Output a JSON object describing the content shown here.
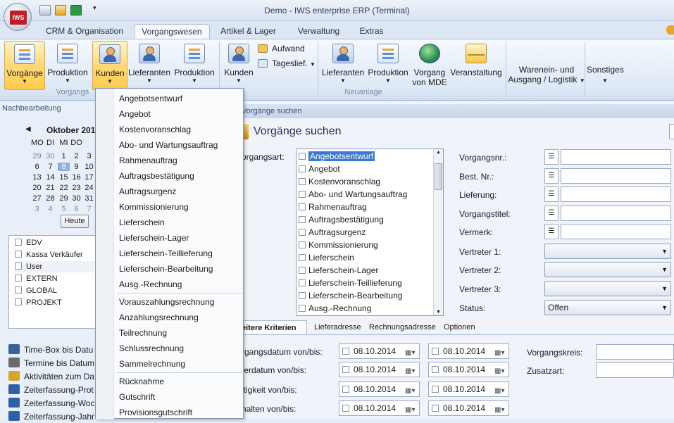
{
  "window": {
    "title": "Demo - IWS enterprise ERP (Terminal)",
    "logo_text": "IWS"
  },
  "tabs": [
    "CRM & Organisation",
    "Vorgangswesen",
    "Artikel & Lager",
    "Verwaltung",
    "Extras"
  ],
  "ribbon": {
    "buttons": {
      "vorgaenge": "Vorgänge",
      "produktion1": "Produktion",
      "kunden1": "Kunden",
      "lieferanten1": "Lieferanten",
      "produktion2": "Produktion",
      "kunden2": "Kunden",
      "aufwand": "Aufwand",
      "tageslief": "Tageslief.",
      "lieferanten2": "Lieferanten",
      "produktion3": "Produktion",
      "vorgang_mde_1": "Vorgang",
      "vorgang_mde_2": "von MDE",
      "veranstaltung": "Veranstaltung",
      "wareneingang_1": "Warenein- und",
      "wareneingang_2": "Ausgang / Logistik",
      "sonstiges": "Sonstiges"
    },
    "groups": {
      "vorgaenge": "Vorgangs",
      "neuanlage": "Neuanlage"
    }
  },
  "left": {
    "header": "Nachbearbeitung",
    "calendar": {
      "month": "Oktober 201",
      "weekdays": [
        "MO",
        "DI",
        "MI",
        "DO"
      ],
      "rows": [
        [
          "29",
          "30",
          "1",
          "2",
          "3"
        ],
        [
          "6",
          "7",
          "8",
          "9",
          "10"
        ],
        [
          "13",
          "14",
          "15",
          "16",
          "17"
        ],
        [
          "20",
          "21",
          "22",
          "23",
          "24"
        ],
        [
          "27",
          "28",
          "29",
          "30",
          "31"
        ],
        [
          "3",
          "4",
          "5",
          "6",
          "7"
        ]
      ],
      "today_label": "Heute"
    },
    "categories": [
      "EDV",
      "Kassa Verkäufer",
      "User",
      "EXTERN",
      "GLOBAL",
      "PROJEKT"
    ],
    "nav": [
      "Time-Box bis Datu",
      "Termine bis Datum",
      "Aktivitäten zum Da",
      "Zeiterfassung-Prot",
      "Zeiterfassung-Woc",
      "Zeiterfassung-Jahr"
    ]
  },
  "main": {
    "breadcrumb": "Vorgänge suchen",
    "title": "Vorgänge suchen",
    "vorgangsart_label": "organgsart:",
    "list": [
      "Angebotsentwurf",
      "Angebot",
      "Kostenvoranschlag",
      "Abo- und Wartungsauftrag",
      "Rahmenauftrag",
      "Auftragsbestätigung",
      "Auftragsurgenz",
      "Kommissionierung",
      "Lieferschein",
      "Lieferschein-Lager",
      "Lieferschein-Teillieferung",
      "Lieferschein-Bearbeitung",
      "Ausg.-Rechnung"
    ],
    "fields": {
      "vorgangsnr": "Vorgangsnr.:",
      "bestnr": "Best. Nr.:",
      "lieferung": "Lieferung:",
      "vorgangstitel": "Vorgangstitel:",
      "vermerk": "Vermerk:",
      "vertreter1": "Vertreter 1:",
      "vertreter2": "Vertreter 2:",
      "vertreter3": "Vertreter 3:",
      "status": "Status:",
      "status_value": "Offen"
    },
    "subtabs": [
      "eitere Kriterien",
      "Lieferadresse",
      "Rechnungsadresse",
      "Optionen"
    ],
    "date_labels": [
      "rgangsdatum von/bis:",
      "ferdatum von/bis:",
      "ltigkeit von/bis:",
      "halten von/bis:"
    ],
    "date_value": "08.10.2014",
    "right_labels": {
      "vorgangskreis": "Vorgangskreis:",
      "zusatzart": "Zusatzart:"
    }
  },
  "menu": {
    "group1": [
      "Angebotsentwurf",
      "Angebot",
      "Kostenvoranschlag",
      "Abo- und Wartungsauftrag",
      "Rahmenauftrag",
      "Auftragsbestätigung",
      "Auftragsurgenz",
      "Kommissionierung",
      "Lieferschein",
      "Lieferschein-Lager",
      "Lieferschein-Teillieferung",
      "Lieferschein-Bearbeitung",
      "Ausg.-Rechnung"
    ],
    "group2": [
      "Vorauszahlungsrechnung",
      "Anzahlungsrechnung",
      "Teilrechnung",
      "Schlussrechnung",
      "Sammelrechnung"
    ],
    "group3": [
      "Rücknahme",
      "Gutschrift",
      "Provisionsgutschrift"
    ]
  }
}
